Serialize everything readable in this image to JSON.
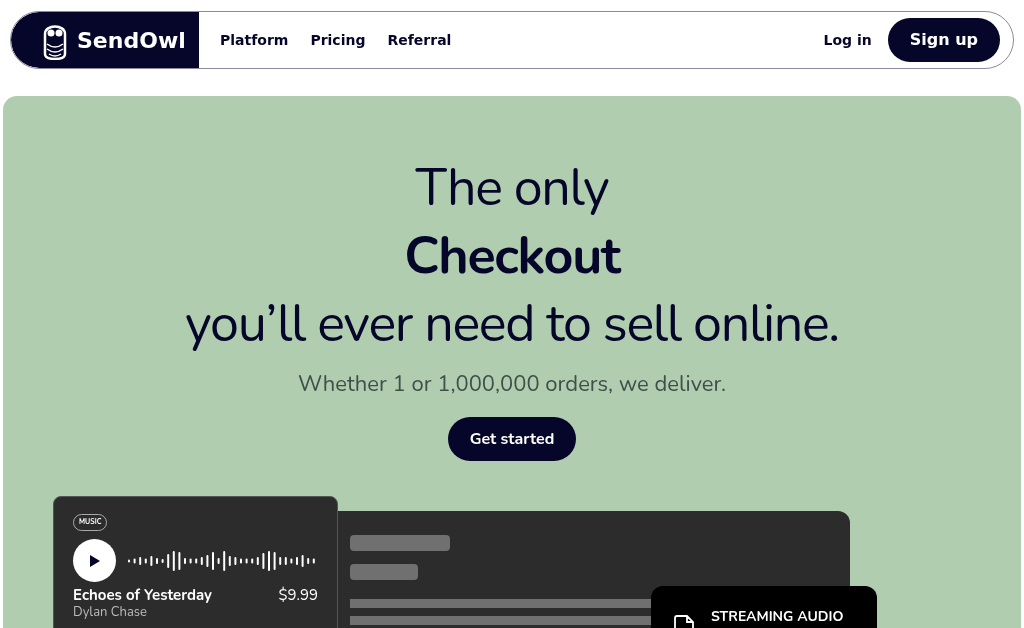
{
  "nav": {
    "brand": "SendOwl",
    "links": [
      "Platform",
      "Pricing",
      "Referral"
    ],
    "login": "Log in",
    "signup": "Sign up"
  },
  "hero": {
    "headline": [
      {
        "text": "The only",
        "bold": false
      },
      {
        "text": "Checkout",
        "bold": true
      },
      {
        "text": "you’ll ever need to sell online.",
        "bold": false
      }
    ],
    "subtitle": "Whether 1 or 1,000,000 orders, we deliver.",
    "cta": "Get started"
  },
  "music_card": {
    "tag": "MUSIC",
    "title": "Echoes of Yesterday",
    "price": "$9.99",
    "artist": "Dylan Chase"
  },
  "feature_card": {
    "label": "STREAMING AUDIO"
  }
}
